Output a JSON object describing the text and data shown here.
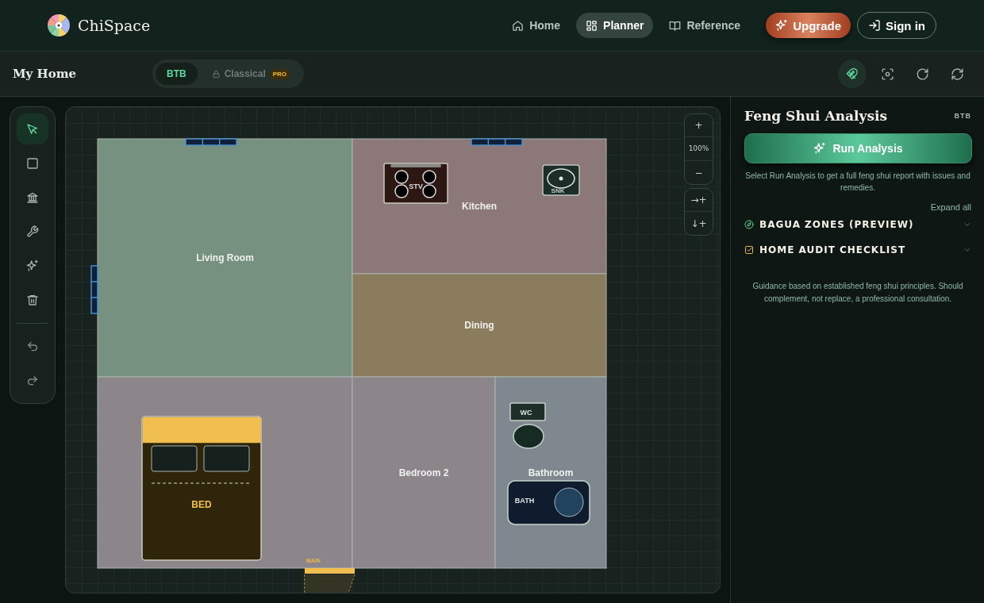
{
  "brand": {
    "name": "ChiSpace"
  },
  "nav": [
    {
      "label": "Home",
      "kind": "home",
      "selected": false
    },
    {
      "label": "Planner",
      "kind": "grid",
      "selected": true
    },
    {
      "label": "Reference",
      "kind": "book",
      "selected": false
    }
  ],
  "upgrade": {
    "label": "Upgrade"
  },
  "sign_in": {
    "label": "Sign in"
  },
  "project": {
    "title": "My Home"
  },
  "modes": [
    {
      "label": "BTB",
      "selected": true,
      "locked": false
    },
    {
      "label": "Classical",
      "selected": false,
      "locked": true,
      "badge": "PRO"
    }
  ],
  "view_tools": [
    {
      "kind": "magnet",
      "selected": true
    },
    {
      "kind": "focus",
      "selected": false
    },
    {
      "kind": "rotate",
      "selected": false
    },
    {
      "kind": "refresh",
      "selected": false
    }
  ],
  "tools": [
    {
      "kind": "pointer",
      "selected": true
    },
    {
      "kind": "rect",
      "selected": false
    },
    {
      "kind": "bank",
      "selected": false
    },
    {
      "kind": "wrench",
      "selected": false
    },
    {
      "kind": "sparkle",
      "selected": false
    },
    {
      "kind": "trash",
      "selected": false
    },
    {
      "kind": "undo",
      "selected": false
    },
    {
      "kind": "redo",
      "selected": false
    }
  ],
  "zoom": {
    "in": "+",
    "level": "100%",
    "out": "−",
    "fit_width": "→+",
    "fit_height": "↓+"
  },
  "rooms": [
    {
      "label": "Living Room",
      "color": "#76917f"
    },
    {
      "label": "Kitchen",
      "color": "#8c7878"
    },
    {
      "label": "Dining",
      "color": "#8c7c5e"
    },
    {
      "color": "#8c868a"
    },
    {
      "label": "Bedroom 2",
      "color": "#8c868a"
    },
    {
      "label": "Bathroom",
      "color": "#7e888e"
    }
  ],
  "furniture": [
    {
      "kind": "stove",
      "label": "STV"
    },
    {
      "kind": "sink",
      "label": "SNK"
    },
    {
      "kind": "toilet",
      "label": "WC"
    },
    {
      "kind": "bed",
      "label": "BED"
    },
    {
      "kind": "bath",
      "label": "BATH"
    }
  ],
  "door": {
    "label": "MAIN"
  },
  "panel": {
    "title": "Feng Shui Analysis",
    "mode": "BTB",
    "run_button": "Run Analysis",
    "hint": "Select Run Analysis to get a full feng shui report with issues and remedies.",
    "expand_all": "Expand all",
    "sections": [
      {
        "kind": "compass",
        "title": "BAGUA ZONES (PREVIEW)",
        "expanded": false
      },
      {
        "kind": "checkbox",
        "title": "HOME AUDIT CHECKLIST",
        "expanded": false
      }
    ],
    "disclaimer": "Guidance based on established feng shui principles. Should complement, not replace, a professional consultation."
  }
}
